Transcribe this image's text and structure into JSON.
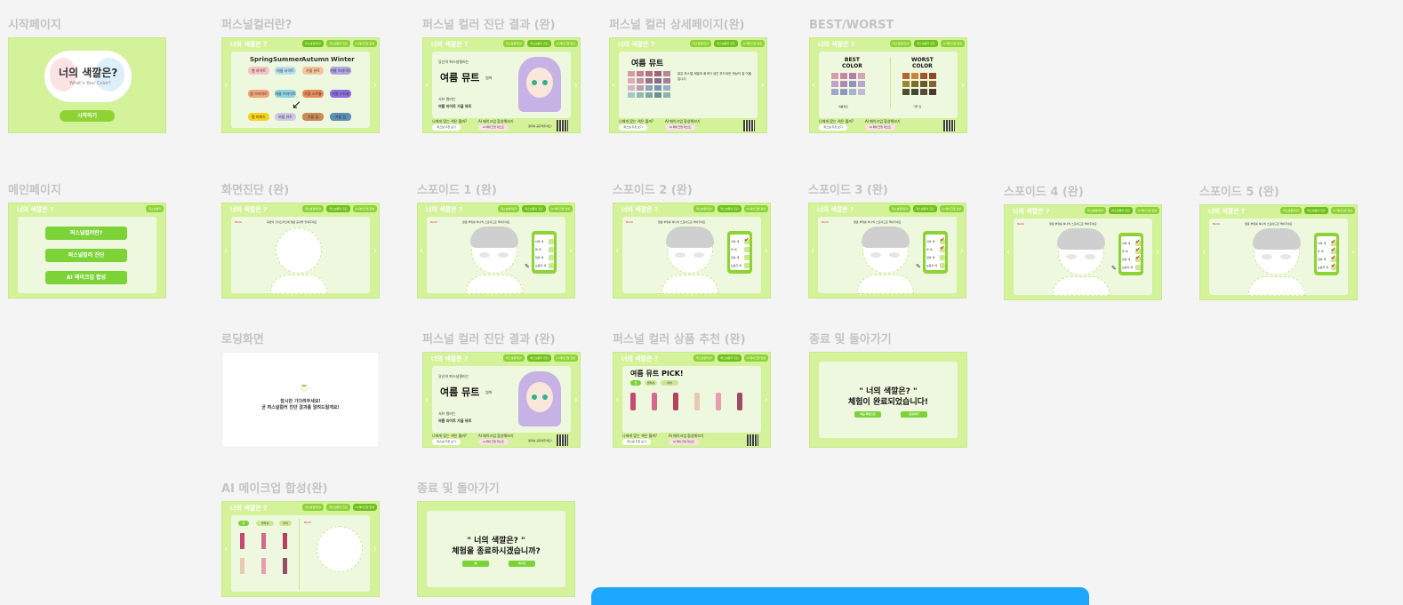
{
  "labels": {
    "start": "시작페이지",
    "pc": "퍼스널컬러란?",
    "res1": "퍼스널 컬러 진단 결과 (완)",
    "detail": "퍼스널 컬러 상세페이지(완)",
    "bw": "BEST/WORST",
    "main": "메인페이지",
    "screen": "화면진단 (완)",
    "sp1": "스포이드 1 (완)",
    "sp2": "스포이드 2 (완)",
    "sp3": "스포이드 3 (완)",
    "sp4": "스포이드 4 (완)",
    "sp5": "스포이드 5 (완)",
    "loading": "로딩화면",
    "res2": "퍼스널 컬러 진단 결과 (완)",
    "rec": "퍼스널 컬러 상품 추천 (완)",
    "end1": "종료 및 돌아가기",
    "ai": "AI 메이크업 합성(완)",
    "end2": "종료 및 돌아가기"
  },
  "app": {
    "header": "너의 색깔은 ?",
    "tab1": "퍼스널컬러란?",
    "tab2": "퍼스널컬러 진단",
    "tab3": "AI 메이크업 합성",
    "start_title": "너의 색깔은?",
    "start_sub": "What's Your Color?",
    "start_btn": "시작하기",
    "main_corner": "퍼스널컬러"
  },
  "seasons": {
    "spring": "Spring",
    "summer": "Summer",
    "autumn": "Autumn",
    "winter": "Winter"
  },
  "season_chips": [
    "봄 라이트",
    "여름 라이트",
    "가을 뮤트",
    "겨울 브라이트",
    "봄 브라이트",
    "여름 브라이트",
    "가을 스트롱",
    "겨울 스트롱",
    "봄 비비드",
    "여름 뮤트",
    "가을 딥",
    "겨울 딥"
  ],
  "main_buttons": [
    "퍼스널컬러란?",
    "퍼스널컬러 진단",
    "AI 메이크업 합성"
  ],
  "result": {
    "small": "당신의 퍼스널컬러는",
    "title": "여름 뮤트",
    "sub": "썸머",
    "best_label": "서브 컬러는",
    "sub_seasons": "여름 라이트   가을 뮤트",
    "btn1": "퍼스널 추천 보기",
    "btn2": "AI 메이크업 테스트",
    "q1": "나에게 맞는 색은 뭘까?",
    "q2": "AI 메이크업 합성해보기",
    "qr_label": "결과를 공유해주세요!"
  },
  "detail": {
    "title": "여름 뮤트",
    "text": "밝은 파스텔 계열과 회색이 섞인 부드러운 색상이 잘 어울립니다"
  },
  "bw": {
    "best": "BEST\nCOLOR",
    "worst": "WORST\nCOLOR",
    "best_tag": "여름뮤트",
    "worst_tag": "가을 딥"
  },
  "screen": {
    "back": "BACK",
    "guide": "화면의 가이드라인에 얼굴 윤곽을 맞춰주세요",
    "sp1": "얼굴 부위를 하나씩 스포이드로 찍어주세요",
    "sp_items": [
      "이마 색",
      "볼 색",
      "입술 색",
      "눈동자 색"
    ]
  },
  "loading": {
    "line1": "잠시만 기다려주세요!",
    "line2": "곧 퍼스널컬러 진단 결과를 알려드릴게요!"
  },
  "rec": {
    "title": "여름 뮤트 PICK!",
    "tabs": [
      "립",
      "블러셔",
      "아이"
    ]
  },
  "end1": {
    "title": "\" 너의 색깔은? \"",
    "line": "체험이 완료되었습니다!",
    "b1": "처음 화면으로",
    "b2": "종료하기"
  },
  "end2": {
    "title": "\" 너의 색깔은? \"",
    "line": "체험을 종료하시겠습니까?",
    "b1": "예",
    "b2": "아니요"
  },
  "colors": {
    "accent": "#7cd337",
    "frame": "#d3f29a",
    "panel": "#eef8df",
    "bottom_bar": "#1ea7ff"
  }
}
